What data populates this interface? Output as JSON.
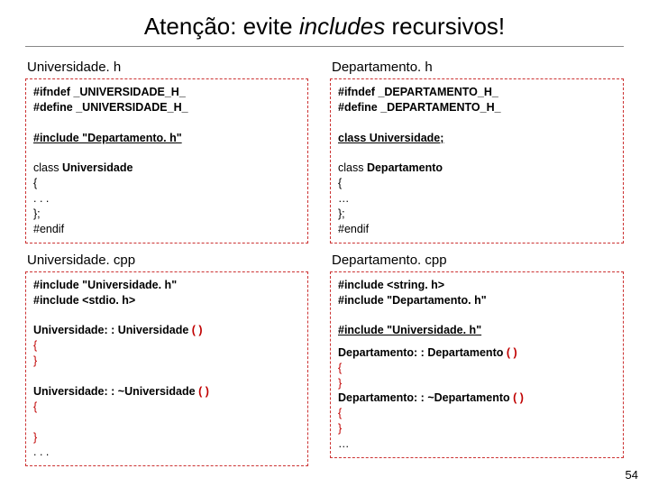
{
  "title_pre": "Atenção: evite ",
  "title_italic": "includes",
  "title_post": " recursivos!",
  "left": {
    "h_name": "Universidade. h",
    "h_l1": "#ifndef _UNIVERSIDADE_H_",
    "h_l2": "#define _UNIVERSIDADE_H_",
    "h_l3": "#include \"Departamento. h\"",
    "h_l4a": "class ",
    "h_l4b": "Universidade",
    "h_l5": "{",
    "h_l6": ". . .",
    "h_l7": "};",
    "h_l8": "#endif",
    "c_name": "Universidade. cpp",
    "c_l1": "#include \"Universidade. h\"",
    "c_l2": "#include <stdio. h>",
    "c_l3a": "Universidade: : Universidade ",
    "c_l3b": "( )",
    "c_l4": "{",
    "c_l5": "}",
    "c_l6a": "Universidade: : ~Universidade ",
    "c_l6b": "( )",
    "c_l7": "{",
    "c_l8": "}",
    "c_l9": ". . ."
  },
  "right": {
    "h_name": "Departamento. h",
    "h_l1": "#ifndef _DEPARTAMENTO_H_",
    "h_l2": "#define _DEPARTAMENTO_H_",
    "h_l3": "class Universidade;",
    "h_l4a": "class ",
    "h_l4b": "Departamento",
    "h_l5": "{",
    "h_l6": " …",
    "h_l7": "};",
    "h_l8": "#endif",
    "c_name": "Departamento. cpp",
    "c_l1": "#include <string. h>",
    "c_l2": "#include \"Departamento. h\"",
    "c_l3": "#include \"Universidade. h\"",
    "c_l4a": "Departamento: : Departamento ",
    "c_l4b": "( )",
    "c_l5": "{",
    "c_l6": "}",
    "c_l7a": "Departamento: : ~Departamento ",
    "c_l7b": "( )",
    "c_l8": "{",
    "c_l9": "}",
    "c_l10": "…"
  },
  "slidenum": "54"
}
